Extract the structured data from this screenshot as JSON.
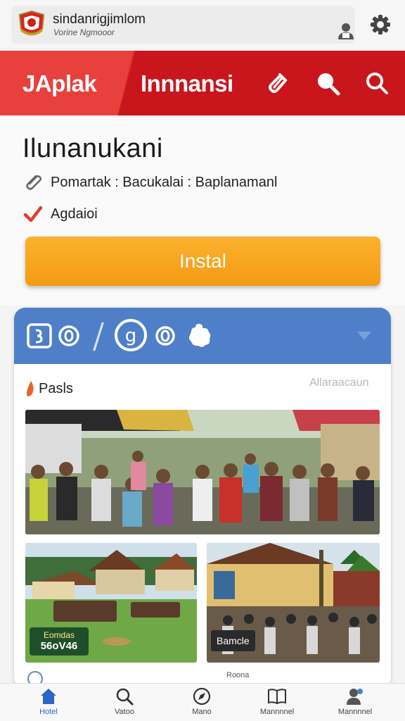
{
  "header": {
    "site_title": "sindanrigjimlom",
    "site_subtitle": "Vorine Ngmooor",
    "brand": "JAplak",
    "menu_title": "Innnansi"
  },
  "content": {
    "title": "Ilunanukani",
    "meta": "Pomartak : Bacukalai : Baplanamanl",
    "status": "Agdaioi",
    "install_label": "Instal"
  },
  "panel": {
    "section_label": "Pasls",
    "side_link": "Allaraacaun",
    "photo2_badge_small": "Eomdas",
    "photo2_badge_big": "56oV46",
    "photo3_tag": "Bamcle",
    "peek_text": "Roona"
  },
  "nav": {
    "items": [
      {
        "label": "Hotel"
      },
      {
        "label": "Vatoo"
      },
      {
        "label": "Mano"
      },
      {
        "label": "Mannnnel"
      }
    ]
  },
  "colors": {
    "red_header": "#dc2a2a",
    "install_orange": "#f59a14",
    "panel_blue": "#4f7fc8",
    "active_nav": "#2b66c8"
  }
}
